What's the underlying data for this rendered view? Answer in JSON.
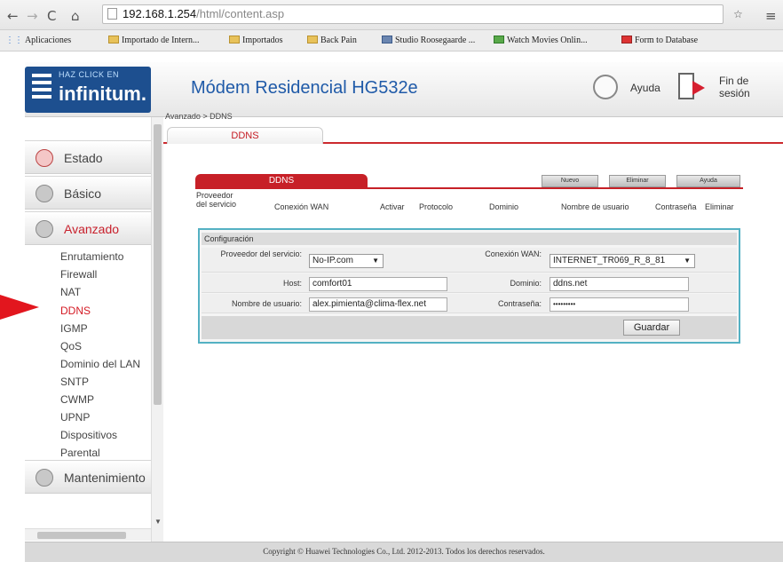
{
  "browser": {
    "url_host": "192.168.1.254",
    "url_path": "/html/content.asp",
    "bookmarks": [
      "Aplicaciones",
      "Importado de Intern...",
      "Importados",
      "Back Pain",
      "Studio Roosegaarde ...",
      "Watch Movies Onlin...",
      "Form to Database"
    ]
  },
  "header": {
    "logo_tag": "HAZ CLICK EN",
    "logo_brand": "infinitum.",
    "title": "Módem Residencial HG532e",
    "help": "Ayuda",
    "logout": "Fin de sesión"
  },
  "sidebar": {
    "sections": [
      "Estado",
      "Básico",
      "Avanzado",
      "Mantenimiento"
    ],
    "items": [
      "Enrutamiento",
      "Firewall",
      "NAT",
      "DDNS",
      "IGMP",
      "QoS",
      "Dominio del LAN",
      "SNTP",
      "CWMP",
      "UPNP",
      "Dispositivos",
      "Parental"
    ]
  },
  "main": {
    "breadcrumb": "Avanzado > DDNS",
    "tab": "DDNS",
    "panel_tab": "DDNS",
    "buttons": [
      "Nuevo",
      "Eliminar",
      "Ayuda"
    ],
    "columns": [
      "Proveedor del servicio",
      "Conexión WAN",
      "Activar",
      "Protocolo",
      "Dominio",
      "Nombre de usuario",
      "Contraseña",
      "Eliminar"
    ],
    "config": {
      "title": "Configuración",
      "provider_label": "Proveedor del servicio:",
      "provider_value": "No-IP.com",
      "wan_label": "Conexión WAN:",
      "wan_value": "INTERNET_TR069_R_8_81",
      "host_label": "Host:",
      "host_value": "comfort01",
      "domain_label": "Dominio:",
      "domain_value": "ddns.net",
      "user_label": "Nombre de usuario:",
      "user_value": "alex.pimienta@clima-flex.net",
      "password_label": "Contraseña:",
      "password_value": "•••••••••",
      "save": "Guardar"
    }
  },
  "footer": "Copyright © Huawei Technologies Co., Ltd. 2012-2013. Todos los derechos reservados.",
  "colors": {
    "accent_red": "#c72027",
    "title_blue": "#1f5aa8",
    "config_border": "#54b1c3"
  }
}
